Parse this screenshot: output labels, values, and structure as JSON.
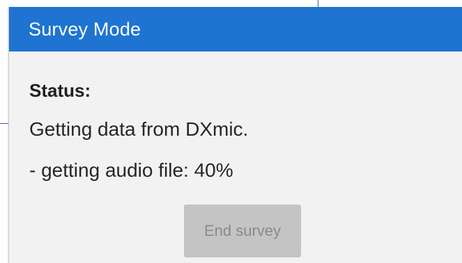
{
  "dialog": {
    "title": "Survey Mode",
    "header_color": "#1f74d2"
  },
  "status": {
    "label": "Status:",
    "line1": "Getting data from DXmic.",
    "line2": "- getting audio file: 40%",
    "audio_progress_percent": 40
  },
  "actions": {
    "end_survey_label": "End survey",
    "end_survey_enabled": false
  }
}
